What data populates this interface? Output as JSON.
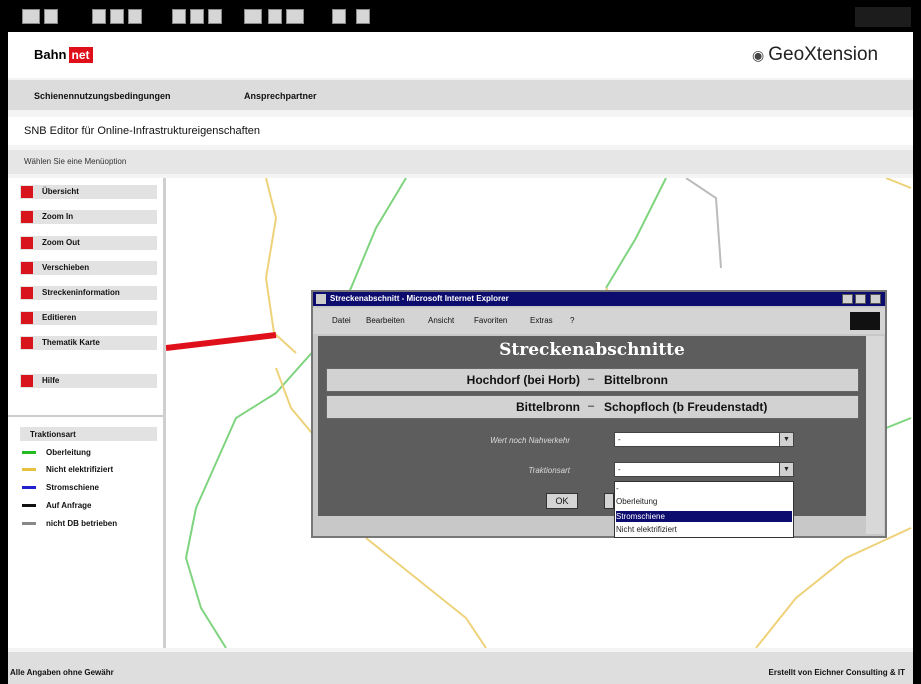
{
  "header": {
    "logo_bahn": "Bahn",
    "logo_net": "net",
    "logo_geo": "GeoXtension"
  },
  "nav": {
    "items": [
      "Schienennutzungsbedingungen",
      "Ansprechpartner"
    ]
  },
  "page": {
    "title": "SNB Editor für Online-Infrastruktureigenschaften",
    "subtitle": "Wählen Sie eine Menüoption"
  },
  "sidebar": {
    "items": [
      {
        "label": "Übersicht",
        "icon": "overview-icon"
      },
      {
        "label": "Zoom In",
        "icon": "zoom-in-icon"
      },
      {
        "label": "Zoom Out",
        "icon": "zoom-out-icon"
      },
      {
        "label": "Verschieben",
        "icon": "pan-icon"
      },
      {
        "label": "Streckeninformation",
        "icon": "info-icon"
      },
      {
        "label": "Editieren",
        "icon": "edit-icon"
      },
      {
        "label": "Thematik Karte",
        "icon": "map-icon"
      },
      {
        "label": "Hilfe",
        "icon": "help-icon"
      }
    ]
  },
  "legend": {
    "title": "Traktionsart",
    "items": [
      {
        "label": "Oberleitung",
        "color": "#22bb22"
      },
      {
        "label": "Nicht elektrifiziert",
        "color": "#e8c040"
      },
      {
        "label": "Stromschiene",
        "color": "#2222cc"
      },
      {
        "label": "Auf Anfrage",
        "color": "#111111"
      },
      {
        "label": "nicht DB betrieben",
        "color": "#888888"
      }
    ]
  },
  "footer": {
    "left": "Alle Angaben ohne Gewähr",
    "right": "Erstellt von Eichner Consulting & IT"
  },
  "popup": {
    "window_title": "Streckenabschnitt - Microsoft Internet Explorer",
    "menu": [
      "Datei",
      "Bearbeiten",
      "Ansicht",
      "Favoriten",
      "Extras",
      "?"
    ],
    "title": "Streckenabschnitte",
    "rows": [
      {
        "from": "Hochdorf (bei Horb)",
        "dash": "–",
        "to": "Bittelbronn"
      },
      {
        "from": "Bittelbronn",
        "dash": "–",
        "to": "Schopfloch (b Freudenstadt)"
      }
    ],
    "field1_label": "Wert noch Nahverkehr",
    "field1_value": "-",
    "field2_label": "Traktionsart",
    "field2_value": "-",
    "ok_label": "OK",
    "options": [
      "-",
      "Oberleitung",
      "Stromschiene",
      "Nicht elektrifiziert"
    ],
    "selected_option": "Stromschiene"
  },
  "colors": {
    "accent": "#e0101a",
    "title_bar": "#0c0c6e",
    "rail_green": "#22bb22",
    "rail_yellow": "#e8c040",
    "highlight": "#e0101a"
  }
}
